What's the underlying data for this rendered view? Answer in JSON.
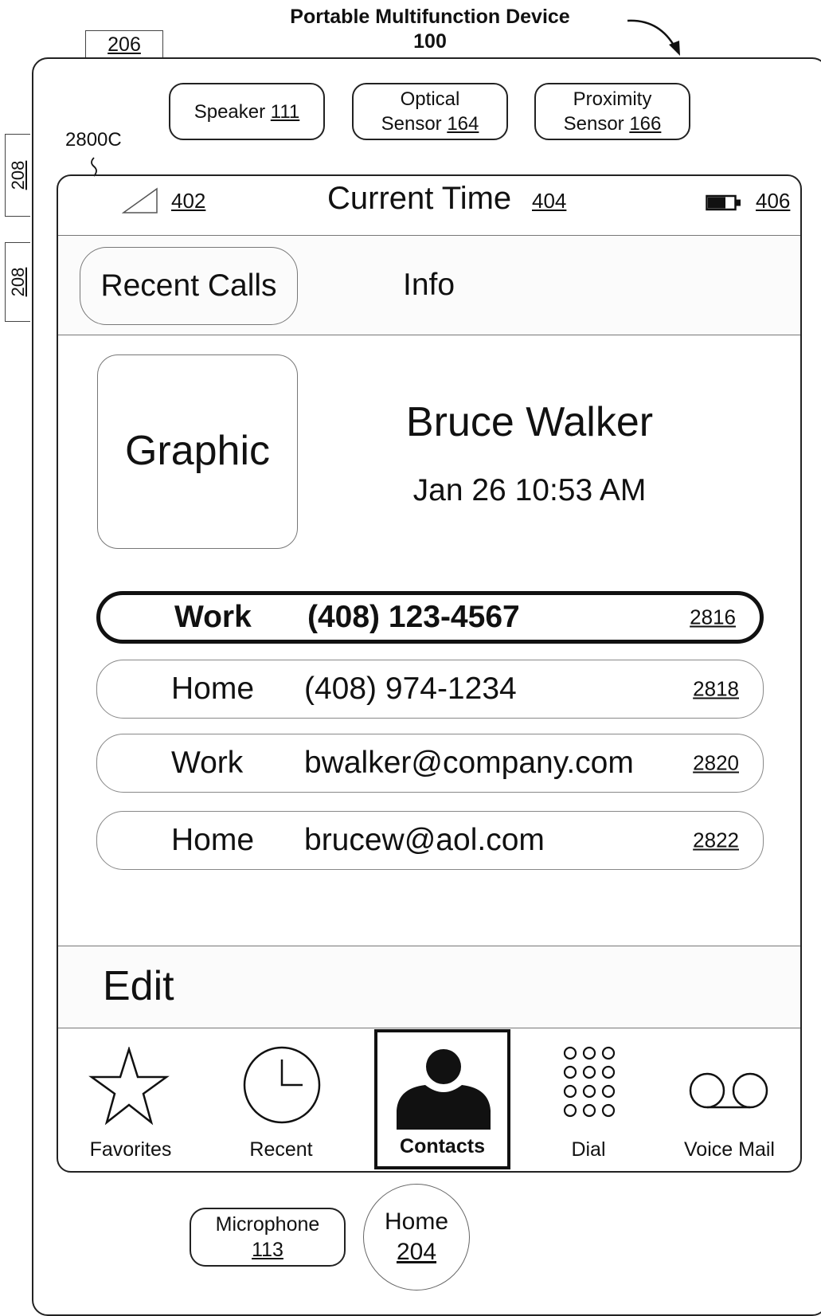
{
  "header": {
    "title": "Portable Multifunction Device",
    "ref": "100"
  },
  "refs": {
    "top_slot": "206",
    "side_a": "208",
    "side_b": "208",
    "screen_label": "2800C"
  },
  "sensors": [
    {
      "name": "Speaker",
      "ref": "111"
    },
    {
      "name": "Optical",
      "name2": "Sensor",
      "ref": "164"
    },
    {
      "name": "Proximity",
      "name2": "Sensor",
      "ref": "166"
    }
  ],
  "status_bar": {
    "signal_ref": "402",
    "time_label": "Current Time",
    "time_ref": "404",
    "battery_ref": "406",
    "signal_icon": "signal-strength-icon",
    "battery_icon": "battery-icon"
  },
  "nav": {
    "back_label": "Recent Calls",
    "title": "Info"
  },
  "contact": {
    "graphic_label": "Graphic",
    "name": "Bruce Walker",
    "timestamp": "Jan 26 10:53 AM"
  },
  "entries": [
    {
      "type": "Work",
      "value": "(408) 123-4567",
      "ref": "2816",
      "selected": true
    },
    {
      "type": "Home",
      "value": "(408) 974-1234",
      "ref": "2818",
      "selected": false
    },
    {
      "type": "Work",
      "value": "bwalker@company.com",
      "ref": "2820",
      "selected": false
    },
    {
      "type": "Home",
      "value": "brucew@aol.com",
      "ref": "2822",
      "selected": false
    }
  ],
  "edit_label": "Edit",
  "tabs": [
    {
      "label": "Favorites",
      "icon": "star-icon"
    },
    {
      "label": "Recent",
      "icon": "clock-icon"
    },
    {
      "label": "Contacts",
      "icon": "person-icon",
      "active": true
    },
    {
      "label": "Dial",
      "icon": "keypad-icon"
    },
    {
      "label": "Voice Mail",
      "icon": "voicemail-icon"
    }
  ],
  "hardware": {
    "microphone_label": "Microphone",
    "microphone_ref": "113",
    "home_label": "Home",
    "home_ref": "204"
  }
}
